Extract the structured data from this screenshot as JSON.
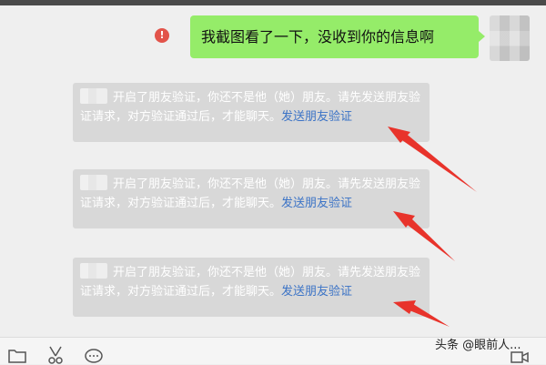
{
  "chat": {
    "sent_message": "我截图看了一下，没收到你的信息啊",
    "error_icon_glyph": "!",
    "system_messages": [
      {
        "text_before_link": "开启了朋友验证，你还不是他（她）朋友。请先发送朋友验证请求，对方验证通过后，才能聊天。",
        "link_text": "发送朋友验证"
      },
      {
        "text_before_link": "开启了朋友验证，你还不是他（她）朋友。请先发送朋友验证请求，对方验证通过后，才能聊天。",
        "link_text": "发送朋友验证"
      },
      {
        "text_before_link": "开启了朋友验证，你还不是他（她）朋友。请先发送朋友验证请求，对方验证通过后，才能聊天。",
        "link_text": "发送朋友验证"
      }
    ]
  },
  "toolbar": {
    "icons": [
      "folder-icon",
      "scissors-icon",
      "chat-bubble-icon",
      "video-call-icon"
    ]
  },
  "watermark": {
    "text": "头条 @眼前人..."
  },
  "colors": {
    "self_bubble": "#95ec69",
    "system_message_bg": "#d8d8d8",
    "link": "#3b73c6",
    "error": "#e2534a",
    "annotation_arrow": "#e8332b"
  }
}
